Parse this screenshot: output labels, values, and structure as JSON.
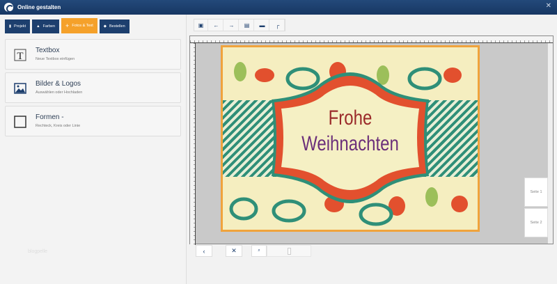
{
  "window": {
    "title": "Online gestalten",
    "close": "✕"
  },
  "tabs": [
    {
      "label": "Projekt",
      "icon": "file-icon"
    },
    {
      "label": "Farben",
      "icon": "bucket-icon"
    },
    {
      "label": "Fotos & Text",
      "icon": "plus-icon"
    },
    {
      "label": "Bestellen",
      "icon": "basket-icon"
    }
  ],
  "items": [
    {
      "title": "Textbox",
      "subtitle": "Neue Textbox einfügen"
    },
    {
      "title": "Bilder & Logos",
      "subtitle": "Auswählen oder Hochladen"
    },
    {
      "title": "Formen -",
      "subtitle": "Rechteck, Kreis oder Linie"
    }
  ],
  "watermark": "blogpelle",
  "card": {
    "line1": "Frohe",
    "line2": "Weihnachten"
  },
  "pages": [
    "Seite 1",
    "Seite 2"
  ],
  "colors": {
    "navy": "#1d3f6e",
    "accent": "#f5a12a"
  }
}
